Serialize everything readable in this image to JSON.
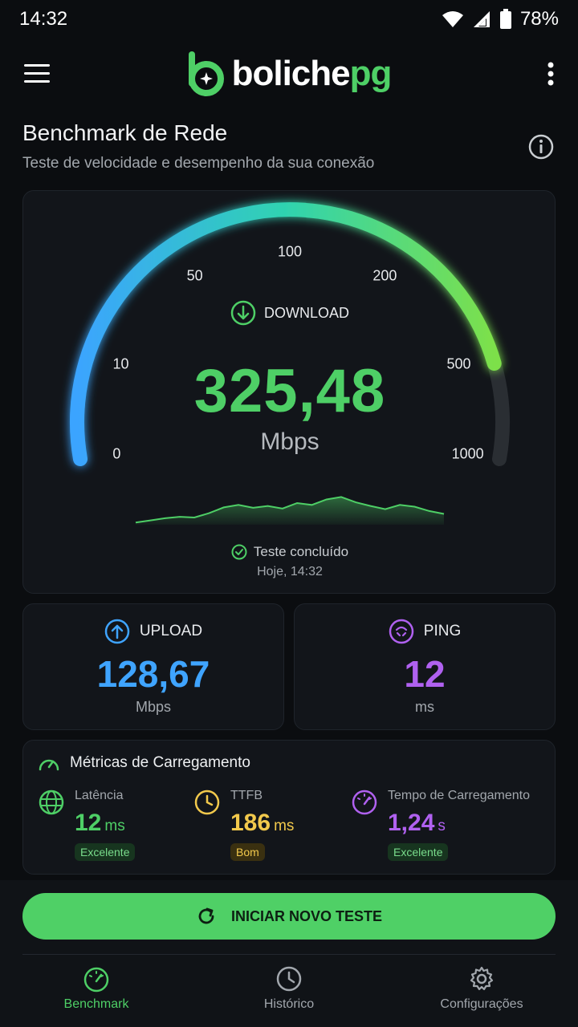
{
  "status": {
    "time": "14:32",
    "battery": "78%"
  },
  "app": {
    "logo_primary": "boliche",
    "logo_accent": "pg"
  },
  "page": {
    "title": "Benchmark de Rede",
    "subtitle": "Teste de velocidade e desempenho da sua conexão"
  },
  "gauge": {
    "ticks": [
      "0",
      "10",
      "50",
      "100",
      "200",
      "500",
      "1000"
    ],
    "label": "DOWNLOAD",
    "value": "325,48",
    "unit": "Mbps",
    "status": "Teste concluído",
    "time": "Hoje, 14:32",
    "fill_fraction": 0.87,
    "sparkline": [
      0.06,
      0.12,
      0.18,
      0.22,
      0.2,
      0.32,
      0.48,
      0.55,
      0.47,
      0.52,
      0.45,
      0.6,
      0.55,
      0.7,
      0.77,
      0.62,
      0.52,
      0.43,
      0.55,
      0.5,
      0.38,
      0.3
    ]
  },
  "upload": {
    "label": "UPLOAD",
    "value": "128,67",
    "unit": "Mbps"
  },
  "ping": {
    "label": "PING",
    "value": "12",
    "unit": "ms"
  },
  "metrics": {
    "title": "Métricas de Carregamento",
    "latency": {
      "label": "Latência",
      "value": "12",
      "unit": "ms",
      "badge": "Excelente"
    },
    "ttfb": {
      "label": "TTFB",
      "value": "186",
      "unit": "ms",
      "badge": "Bom"
    },
    "load": {
      "label": "Tempo de Carregamento",
      "value": "1,24",
      "unit": "s",
      "badge": "Excelente"
    }
  },
  "cta": {
    "label": "INICIAR NOVO TESTE"
  },
  "nav": {
    "benchmark": "Benchmark",
    "history": "Histórico",
    "settings": "Configurações"
  },
  "colors": {
    "accent": "#4ecf66",
    "upload": "#3fa4ff",
    "ping": "#b061f0",
    "ttfb": "#f2c94c",
    "background": "#0b0d10"
  }
}
